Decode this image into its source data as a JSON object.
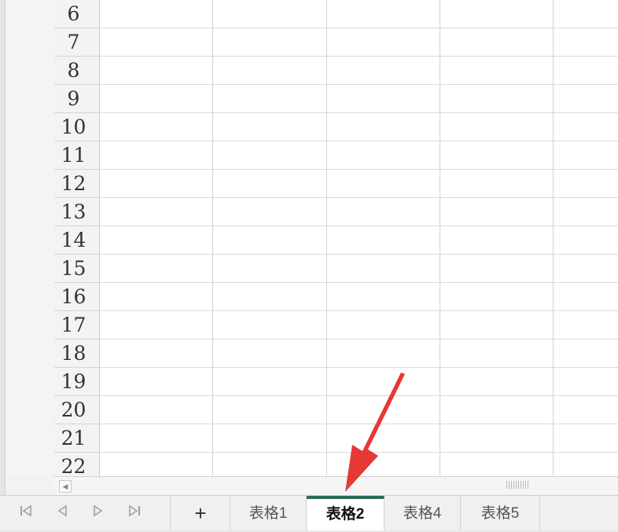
{
  "row_numbers": [
    "6",
    "7",
    "8",
    "9",
    "10",
    "11",
    "12",
    "13",
    "14",
    "15",
    "16",
    "17",
    "18",
    "19",
    "20",
    "21",
    "22"
  ],
  "tab_nav": {
    "first_icon": "first-sheet-icon",
    "prev_icon": "previous-sheet-icon",
    "next_icon": "next-sheet-icon",
    "last_icon": "last-sheet-icon"
  },
  "add_tab_label": "+",
  "sheet_tabs": [
    {
      "label": "表格1",
      "active": false
    },
    {
      "label": "表格2",
      "active": true
    },
    {
      "label": "表格4",
      "active": false
    },
    {
      "label": "表格5",
      "active": false
    }
  ],
  "colors": {
    "active_tab_accent": "#2d6a59",
    "annotation_arrow": "#e53935"
  },
  "annotation": {
    "type": "arrow",
    "points_to": "表格2"
  }
}
